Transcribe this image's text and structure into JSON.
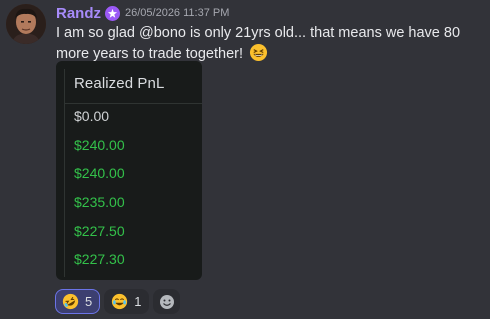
{
  "message": {
    "author": "Randz",
    "author_color": "#a78bfa",
    "badge_icon": "nitro-badge-icon",
    "timestamp": "26/05/2026 11:37 PM",
    "text": "I am so glad @bono is only 21yrs old... that means we have 80 more years to trade together!",
    "trailing_emoji": "grinning-squinting-face-emoji"
  },
  "attachment": {
    "header": "Realized PnL",
    "rows": [
      "$0.00",
      "$240.00",
      "$240.00",
      "$235.00",
      "$227.50",
      "$227.30"
    ],
    "positive_color": "#33c14a"
  },
  "reactions": [
    {
      "emoji": "rolling-on-floor-laughing-emoji",
      "count": "5",
      "active": true
    },
    {
      "emoji": "face-with-tears-of-joy-emoji",
      "count": "1",
      "active": false
    }
  ],
  "add_reaction_icon": "add-reaction-icon"
}
